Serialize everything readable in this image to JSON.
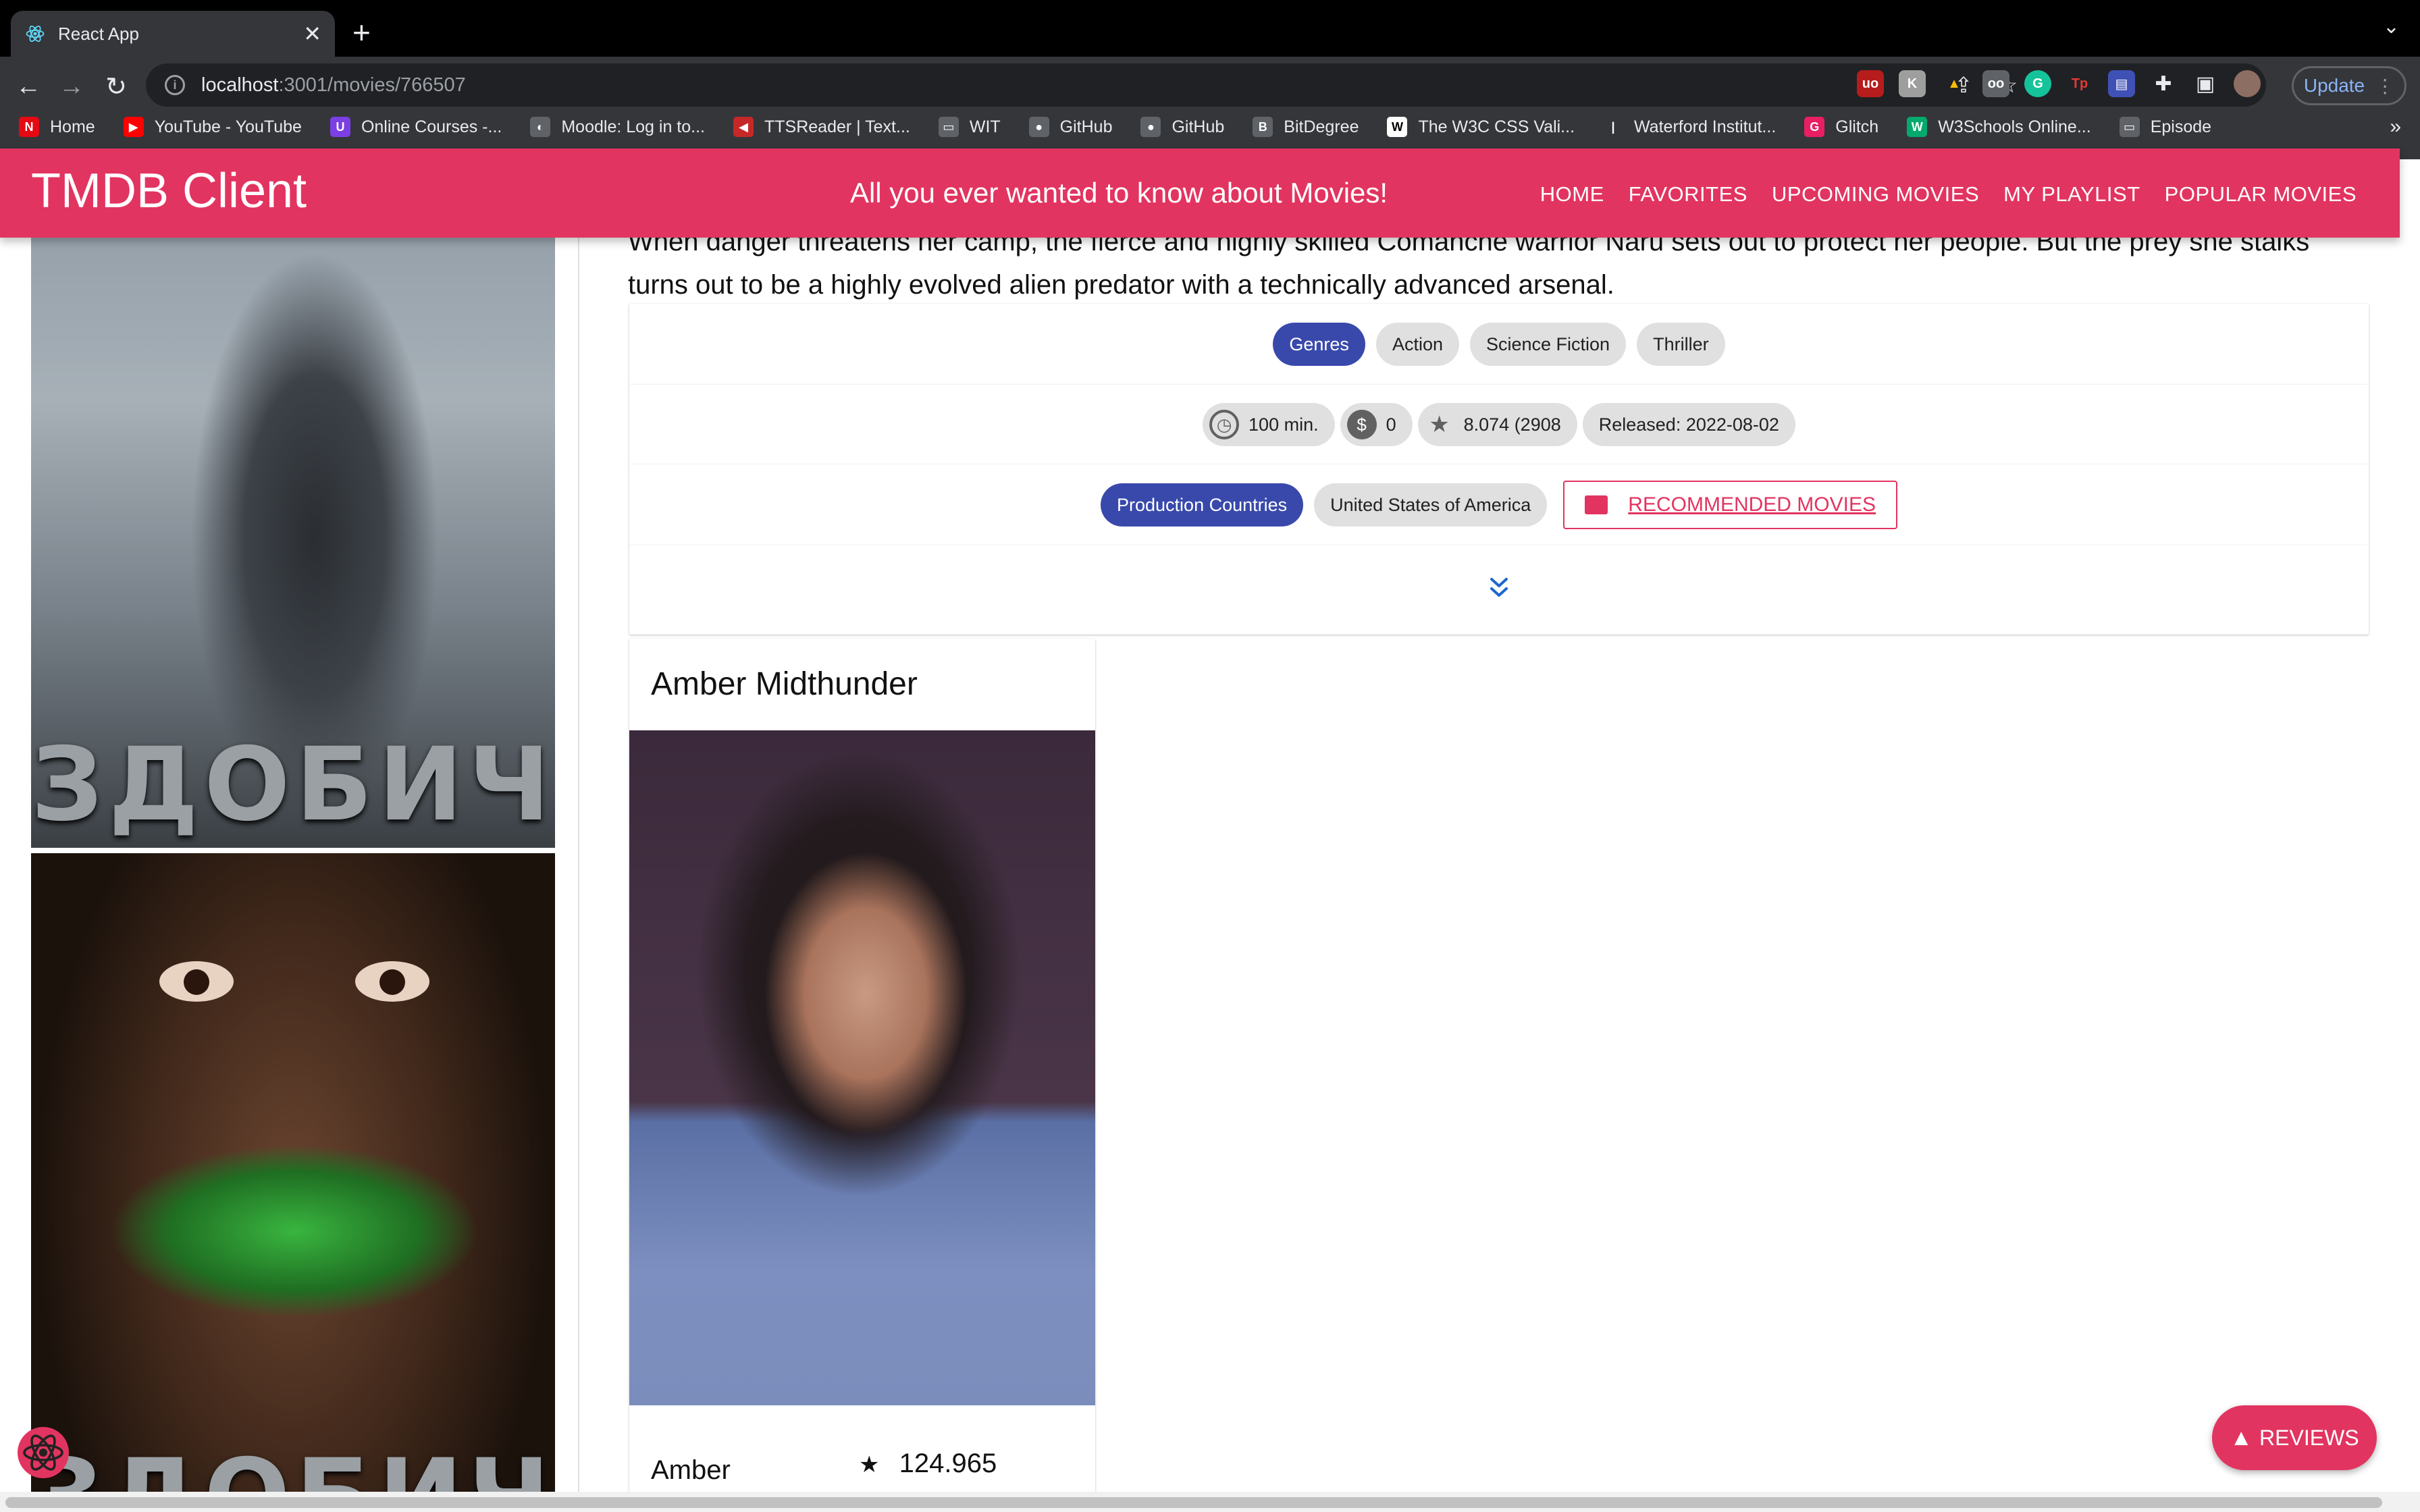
{
  "browser": {
    "tab_title": "React App",
    "tab_close": "✕",
    "new_tab": "+",
    "tab_menu": "⌄",
    "url_host": "localhost",
    "url_path": ":3001/movies/766507",
    "update_label": "Update",
    "update_menu": "⋮",
    "bookmarks_more": "»",
    "bookmarks": [
      {
        "label": "Home",
        "icon": "netflix-icon",
        "color": "#e50914",
        "glyph": "N"
      },
      {
        "label": "YouTube - YouTube",
        "icon": "youtube-icon",
        "color": "#ff0000",
        "glyph": "▶"
      },
      {
        "label": "Online Courses -...",
        "icon": "courses-icon",
        "color": "#7b3fe4",
        "glyph": "U"
      },
      {
        "label": "Moodle: Log in to...",
        "icon": "moodle-icon",
        "color": "#5f6368",
        "glyph": "◐"
      },
      {
        "label": "TTSReader | Text...",
        "icon": "speaker-icon",
        "color": "#c62828",
        "glyph": "◀"
      },
      {
        "label": "WIT",
        "icon": "folder-icon",
        "color": "#5f6368",
        "glyph": "▭"
      },
      {
        "label": "GitHub",
        "icon": "github-icon",
        "color": "#5f6368",
        "glyph": "●"
      },
      {
        "label": "GitHub",
        "icon": "github-icon",
        "color": "#5f6368",
        "glyph": "●"
      },
      {
        "label": "BitDegree",
        "icon": "bitdegree-icon",
        "color": "#5f6368",
        "glyph": "B"
      },
      {
        "label": "The W3C CSS Vali...",
        "icon": "w3c-icon",
        "color": "#ffffff",
        "glyph": "W"
      },
      {
        "label": "Waterford Institut...",
        "icon": "waterford-icon",
        "color": "#35363a",
        "glyph": "|"
      },
      {
        "label": "Glitch",
        "icon": "glitch-icon",
        "color": "#e91e63",
        "glyph": "G"
      },
      {
        "label": "W3Schools Online...",
        "icon": "w3schools-icon",
        "color": "#04aa6d",
        "glyph": "W"
      },
      {
        "label": "Episode",
        "icon": "folder-icon",
        "color": "#5f6368",
        "glyph": "▭"
      }
    ]
  },
  "header": {
    "brand": "TMDB Client",
    "tagline": "All you ever wanted to know about Movies!",
    "nav": [
      "Home",
      "Favorites",
      "Upcoming Movies",
      "My Playlist",
      "Popular Movies"
    ]
  },
  "posters": {
    "title_text": "ЗДОБИЧ"
  },
  "movie": {
    "overview": "When danger threatens her camp, the fierce and highly skilled Comanche warrior Naru sets out to protect her people. But the prey she stalks turns out to be a highly evolved alien predator with a technically advanced arsenal.",
    "genres_label": "Genres",
    "genres": [
      "Action",
      "Science Fiction",
      "Thriller"
    ],
    "runtime": "100 min.",
    "revenue": "0",
    "rating": "8.074 (2908",
    "released": "Released: 2022-08-02",
    "countries_label": "Production Countries",
    "countries": [
      "United States of America"
    ],
    "recommended_label": "Recommended Movies",
    "expand_glyph": "⌄"
  },
  "cast": {
    "header_name": "Amber Midthunder",
    "bottom_name": "Amber Midthunder",
    "popularity": "124.965",
    "star_glyph": "★"
  },
  "fab": {
    "label": "Reviews"
  },
  "colors": {
    "brand": "#e23460",
    "chip_primary": "#3949ab"
  }
}
